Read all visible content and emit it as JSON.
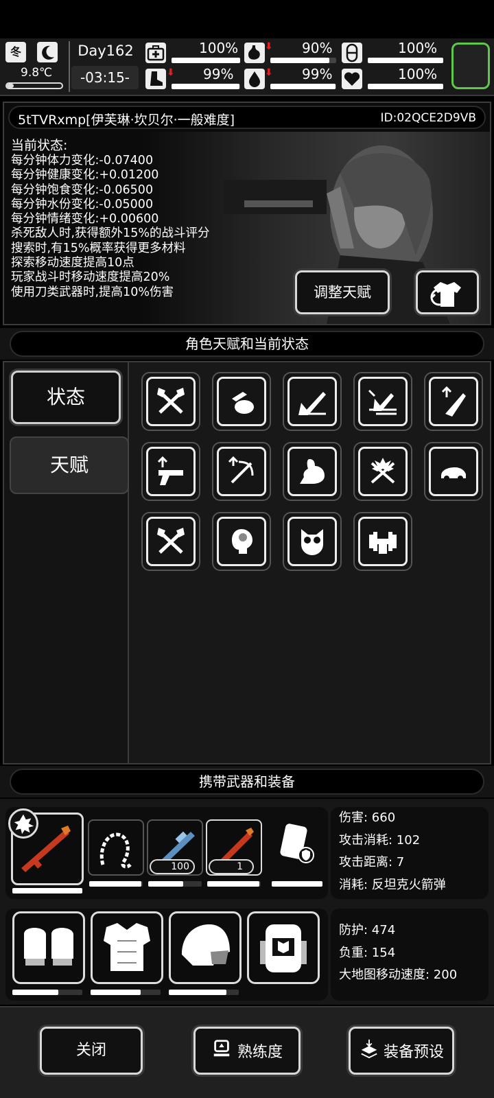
{
  "hud": {
    "season": "冬",
    "temperature": "9.8℃",
    "day": "Day162",
    "time": "-03:15-",
    "stats": [
      {
        "icon": "medkit-icon",
        "value": "100%",
        "fill": 1.0,
        "decreasing": false
      },
      {
        "icon": "stomach-icon",
        "value": "90%",
        "fill": 0.9,
        "decreasing": true
      },
      {
        "icon": "capsule-icon",
        "value": "100%",
        "fill": 1.0,
        "decreasing": false
      },
      {
        "icon": "boot-icon",
        "value": "99%",
        "fill": 0.99,
        "decreasing": true
      },
      {
        "icon": "water-drop-icon",
        "value": "99%",
        "fill": 0.99,
        "decreasing": true
      },
      {
        "icon": "heart-icon",
        "value": "100%",
        "fill": 1.0,
        "decreasing": false
      }
    ]
  },
  "character": {
    "name": "5tTVRxmp[伊芙琳·坎贝尔·一般难度]",
    "id": "ID:02QCE2D9VB",
    "status_title": "当前状态:",
    "status_lines": [
      "每分钟体力变化:-0.07400",
      "每分钟健康变化:+0.01200",
      "每分钟饱食变化:-0.06500",
      "每分钟水份变化:-0.05000",
      "每分钟情绪变化:+0.00600",
      "杀死敌人时,获得额外15%的战斗评分",
      "搜索时,有15%概率获得更多材料",
      "探索移动速度提高10点",
      "玩家战斗时移动速度提高20%",
      "使用刀类武器时,提高10%伤害"
    ],
    "adjust_talent_label": "调整天赋"
  },
  "talents_section": {
    "title": "角色天赋和当前状态",
    "tabs": [
      {
        "label": "状态",
        "selected": false
      },
      {
        "label": "天赋",
        "selected": true
      }
    ],
    "talent_icons": [
      "crossed-axes-icon",
      "grab-sack-icon",
      "sprint-icon",
      "dash-icon",
      "blade-up-icon",
      "pistol-up-icon",
      "crossbow-up-icon",
      "muscle-icon",
      "crossed-swords-icon",
      "car-icon",
      "crossed-axes-icon",
      "brain-icon",
      "owl-icon",
      "dumbbell-icon"
    ]
  },
  "equipment_section": {
    "title": "携带武器和装备",
    "weapons": [
      {
        "icon": "rocket-launcher-icon",
        "count": "",
        "durability": 1.0
      },
      {
        "icon": "chain-whip-icon",
        "count": "",
        "durability": 0.98
      },
      {
        "icon": "blue-rifle-icon",
        "count": "100",
        "durability": 0.65
      },
      {
        "icon": "rocket-launcher-icon",
        "count": "1",
        "durability": 0.98
      },
      {
        "icon": "shield-pack-icon",
        "count": "",
        "durability": 1.0
      }
    ],
    "weapon_stats": [
      "伤害: 660",
      "攻击消耗: 102",
      "攻击距离: 7",
      "消耗: 反坦克火箭弹"
    ],
    "armor": [
      {
        "icon": "gloves-icon",
        "durability": 0.66
      },
      {
        "icon": "body-armor-icon",
        "durability": 0.72
      },
      {
        "icon": "helmet-icon",
        "durability": 0.82
      },
      {
        "icon": "backpack-icon",
        "durability": 0.0
      }
    ],
    "armor_stats": [
      "防护: 474",
      "负重: 154",
      "大地图移动速度: 200"
    ]
  },
  "footer": {
    "close_label": "关闭",
    "proficiency_label": "熟练度",
    "preset_label": "装备预设"
  },
  "colors": {
    "alert": "#e02020",
    "green_frame": "#5fc84a"
  }
}
